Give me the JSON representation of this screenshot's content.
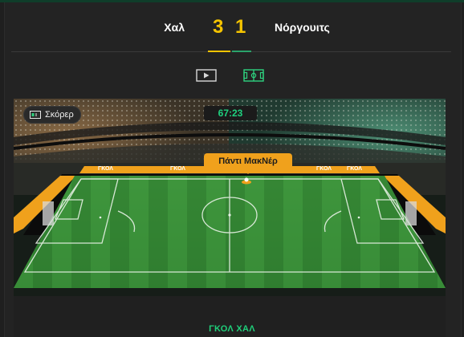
{
  "match": {
    "home_team": "Χαλ",
    "away_team": "Νόργουιτς",
    "home_score": "3",
    "away_score": "1"
  },
  "view_toggle": {
    "video_icon": "play-icon",
    "pitch_icon": "pitch-icon"
  },
  "field": {
    "scorer_label": "Σκόρερ",
    "time": "67:23",
    "player_name": "Πάντι ΜακΝέρ",
    "board_text": "ΓΚΟΛ"
  },
  "event": {
    "label": "ΓΚΟΛ ΧΑΛ"
  },
  "colors": {
    "accent_gold": "#f5c400",
    "accent_green": "#1fcf7a",
    "board_orange": "#f0a11c",
    "pitch_green": "#3b9a3c"
  }
}
